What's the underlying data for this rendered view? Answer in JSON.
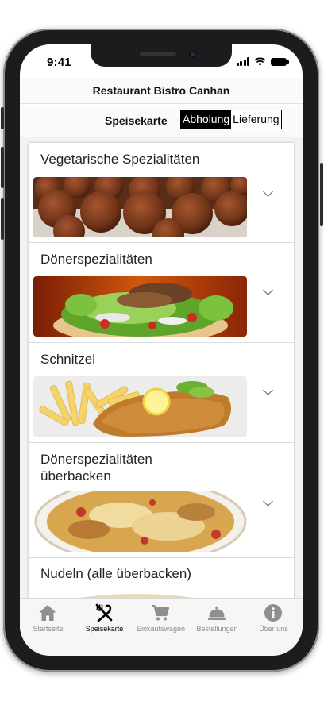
{
  "status_bar": {
    "time": "9:41"
  },
  "header": {
    "title": "Restaurant Bistro Canhan"
  },
  "subheader": {
    "menu_label": "Speisekarte",
    "segments": [
      {
        "label": "Abholung",
        "selected": true
      },
      {
        "label": "Lieferung",
        "selected": false
      }
    ]
  },
  "categories": [
    {
      "name": "Vegetarische Spezialitäten",
      "image": "falafel-photo"
    },
    {
      "name": "Dönerspezialitäten",
      "image": "doner-photo"
    },
    {
      "name": "Schnitzel",
      "image": "schnitzel-photo"
    },
    {
      "name": "Dönerspezialitäten überbacken",
      "image": "baked-doner-photo"
    },
    {
      "name": "Nudeln (alle überbacken)",
      "image": "pasta-photo"
    }
  ],
  "tab_bar": {
    "tabs": [
      {
        "label": "Startseite",
        "icon": "home-icon",
        "active": false
      },
      {
        "label": "Speisekarte",
        "icon": "utensils-icon",
        "active": true
      },
      {
        "label": "Einkaufswagen",
        "icon": "cart-icon",
        "active": false
      },
      {
        "label": "Bestellungen",
        "icon": "cloche-icon",
        "active": false
      },
      {
        "label": "Über uns",
        "icon": "info-icon",
        "active": false
      }
    ]
  },
  "colors": {
    "active_tab": "#000000",
    "inactive_tab": "#8e8e93",
    "segment_active_bg": "#000000"
  }
}
